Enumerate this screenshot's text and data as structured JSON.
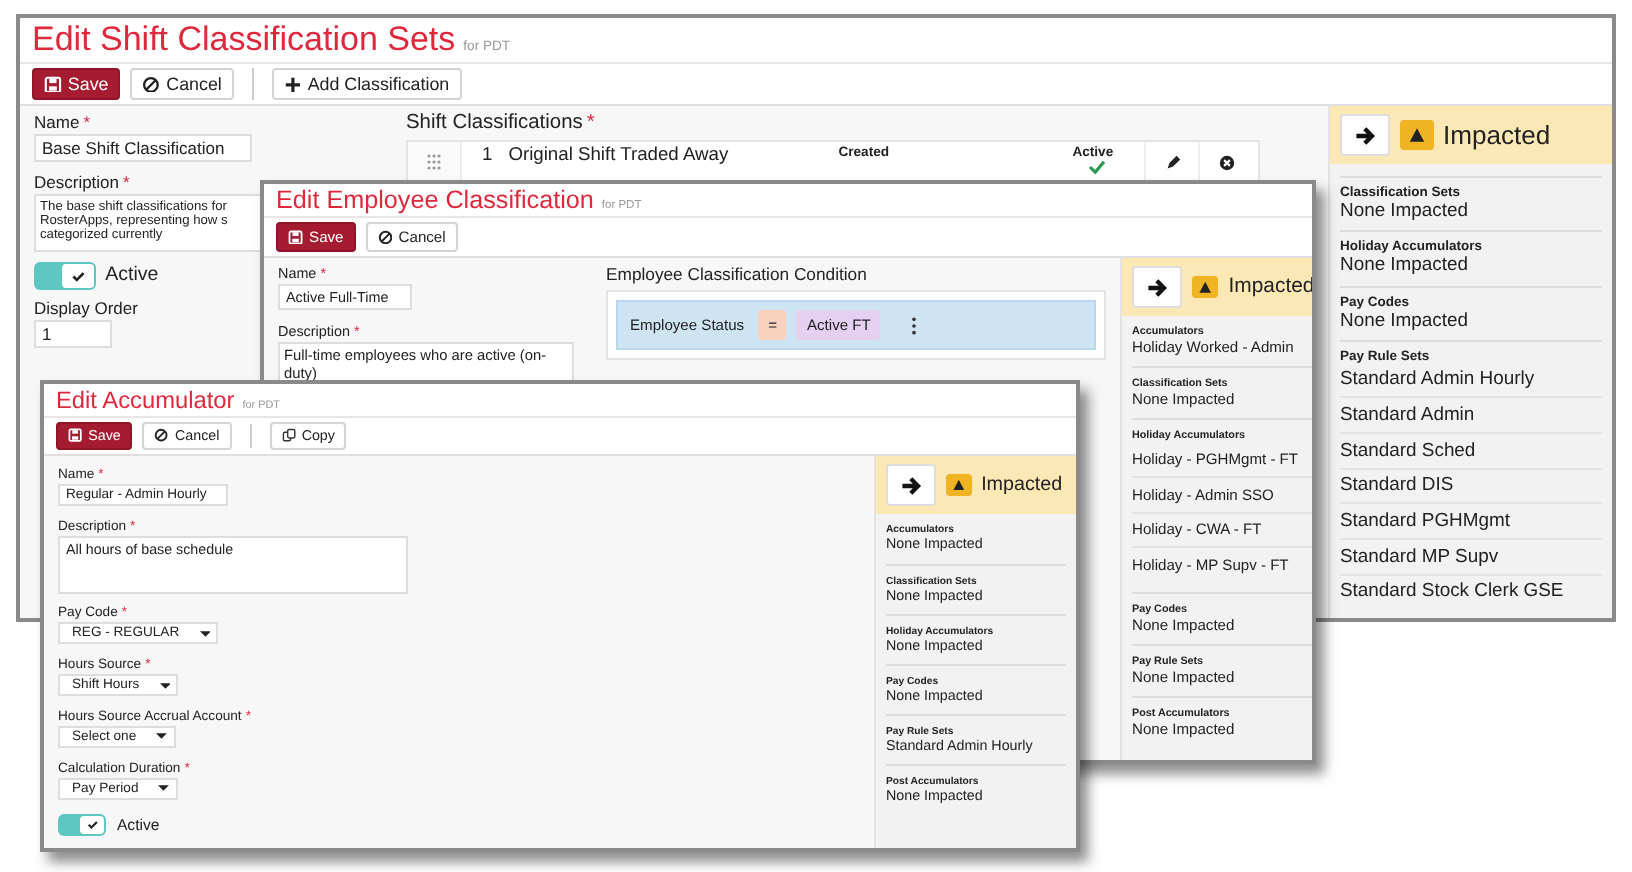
{
  "windows": [
    {
      "kind": "shift_sets",
      "title": "Edit Shift Classification Sets",
      "scope": "for PDT",
      "buttons": [
        {
          "label": "Save",
          "kind": "save"
        },
        {
          "label": "Cancel",
          "kind": "cancel"
        },
        {
          "label": "Add Classification",
          "kind": "add"
        }
      ],
      "fields": [
        {
          "label": "Name",
          "mark": "*",
          "kind": "input",
          "value": "Base Shift Classification"
        },
        {
          "label": "Description",
          "mark": "*",
          "kind": "textarea",
          "value": "The base shift classifications for\nRosterApps, representing how s\ncategorized currently"
        },
        {
          "label": "Active",
          "kind": "toggle",
          "checked": true
        },
        {
          "label": "Display Order",
          "kind": "input",
          "value": "1"
        }
      ],
      "classifications": {
        "heading": "Shift Classifications",
        "mark": "*",
        "rows": [
          {
            "number": "1",
            "name": "Original Shift Traded Away",
            "created_header": "Created",
            "active_header": "Active",
            "active": true
          }
        ]
      },
      "impacted": {
        "label": "Impacted",
        "sections": [
          {
            "heading": "Classification Sets",
            "items": [
              "None Impacted"
            ]
          },
          {
            "heading": "Holiday Accumulators",
            "items": [
              "None Impacted"
            ]
          },
          {
            "heading": "Pay Codes",
            "items": [
              "None Impacted"
            ]
          },
          {
            "heading": "Pay Rule Sets",
            "items": [
              "Standard Admin Hourly",
              "Standard Admin",
              "Standard Sched",
              "Standard DIS",
              "Standard PGHMgmt",
              "Standard MP Supv",
              "Standard Stock Clerk GSE"
            ]
          }
        ]
      }
    },
    {
      "kind": "employee_classification",
      "title": "Edit Employee Classification",
      "scope": "for PDT",
      "buttons": [
        {
          "label": "Save",
          "kind": "save"
        },
        {
          "label": "Cancel",
          "kind": "cancel"
        }
      ],
      "fields": [
        {
          "label": "Name",
          "mark": "*",
          "kind": "input",
          "value": "Active Full-Time"
        },
        {
          "label": "Description",
          "mark": "*",
          "kind": "textarea",
          "value": "Full-time employees who are active (on-duty)"
        }
      ],
      "condition": {
        "heading": "Employee Classification Condition",
        "field": "Employee Status",
        "operator": "=",
        "value": "Active FT"
      },
      "impacted": {
        "label": "Impacted",
        "sections": [
          {
            "heading": "Accumulators",
            "items": [
              "Holiday Worked - Admin"
            ]
          },
          {
            "heading": "Classification Sets",
            "items": [
              "None Impacted"
            ]
          },
          {
            "heading": "Holiday Accumulators",
            "items": [
              "Holiday - PGHMgmt - FT",
              "Holiday - Admin SSO",
              "Holiday - CWA - FT",
              "Holiday - MP Supv - FT"
            ]
          },
          {
            "heading": "Pay Codes",
            "items": [
              "None Impacted"
            ]
          },
          {
            "heading": "Pay Rule Sets",
            "items": [
              "None Impacted"
            ]
          },
          {
            "heading": "Post Accumulators",
            "items": [
              "None Impacted"
            ]
          }
        ]
      }
    },
    {
      "kind": "accumulator",
      "title": "Edit Accumulator",
      "scope": "for PDT",
      "buttons": [
        {
          "label": "Save",
          "kind": "save"
        },
        {
          "label": "Cancel",
          "kind": "cancel"
        },
        {
          "label": "Copy",
          "kind": "copy"
        }
      ],
      "fields": [
        {
          "label": "Name",
          "mark": "*",
          "kind": "input",
          "value": "Regular - Admin Hourly"
        },
        {
          "label": "Description",
          "mark": "*",
          "kind": "textarea",
          "value": "All hours of base schedule"
        },
        {
          "label": "Pay Code",
          "mark": "*",
          "kind": "select",
          "value": "REG - REGULAR"
        },
        {
          "label": "Hours Source",
          "mark": "*",
          "kind": "select",
          "value": "Shift Hours"
        },
        {
          "label": "Hours Source Accrual Account",
          "mark": "*",
          "kind": "select",
          "value": "Select one"
        },
        {
          "label": "Calculation Duration",
          "mark": "*",
          "kind": "select",
          "value": "Pay Period"
        },
        {
          "label": "Active",
          "kind": "toggle",
          "checked": true
        }
      ],
      "impacted": {
        "label": "Impacted",
        "sections": [
          {
            "heading": "Accumulators",
            "items": [
              "None Impacted"
            ]
          },
          {
            "heading": "Classification Sets",
            "items": [
              "None Impacted"
            ]
          },
          {
            "heading": "Holiday Accumulators",
            "items": [
              "None Impacted"
            ]
          },
          {
            "heading": "Pay Codes",
            "items": [
              "None Impacted"
            ]
          },
          {
            "heading": "Pay Rule Sets",
            "items": [
              "Standard Admin Hourly"
            ]
          },
          {
            "heading": "Post Accumulators",
            "items": [
              "None Impacted"
            ]
          }
        ]
      }
    }
  ]
}
